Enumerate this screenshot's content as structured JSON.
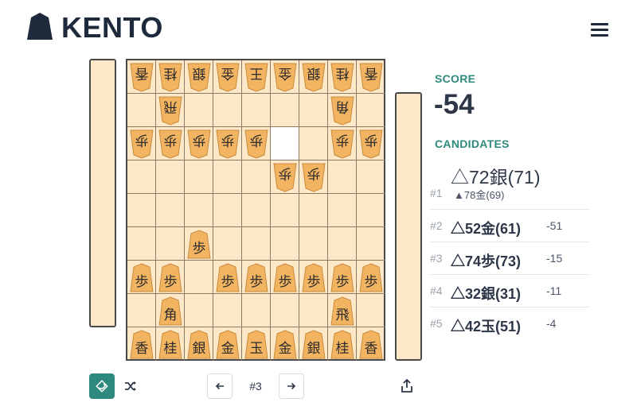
{
  "header": {
    "brand": "KENTO",
    "logo_icon": "shogi-piece-logo-icon",
    "menu_icon": "hamburger-menu-icon"
  },
  "board": {
    "files": 9,
    "ranks": 9,
    "highlight": [
      {
        "file": 4,
        "rank": 3
      }
    ],
    "pieces": [
      {
        "file": 9,
        "rank": 1,
        "char": "香",
        "owner": "gote"
      },
      {
        "file": 8,
        "rank": 1,
        "char": "桂",
        "owner": "gote"
      },
      {
        "file": 7,
        "rank": 1,
        "char": "銀",
        "owner": "gote"
      },
      {
        "file": 6,
        "rank": 1,
        "char": "金",
        "owner": "gote"
      },
      {
        "file": 5,
        "rank": 1,
        "char": "王",
        "owner": "gote"
      },
      {
        "file": 4,
        "rank": 1,
        "char": "金",
        "owner": "gote"
      },
      {
        "file": 3,
        "rank": 1,
        "char": "銀",
        "owner": "gote"
      },
      {
        "file": 2,
        "rank": 1,
        "char": "桂",
        "owner": "gote"
      },
      {
        "file": 1,
        "rank": 1,
        "char": "香",
        "owner": "gote"
      },
      {
        "file": 8,
        "rank": 2,
        "char": "飛",
        "owner": "gote"
      },
      {
        "file": 2,
        "rank": 2,
        "char": "角",
        "owner": "gote"
      },
      {
        "file": 9,
        "rank": 3,
        "char": "歩",
        "owner": "gote"
      },
      {
        "file": 8,
        "rank": 3,
        "char": "歩",
        "owner": "gote"
      },
      {
        "file": 7,
        "rank": 3,
        "char": "歩",
        "owner": "gote"
      },
      {
        "file": 6,
        "rank": 3,
        "char": "歩",
        "owner": "gote"
      },
      {
        "file": 5,
        "rank": 3,
        "char": "歩",
        "owner": "gote"
      },
      {
        "file": 2,
        "rank": 3,
        "char": "歩",
        "owner": "gote"
      },
      {
        "file": 1,
        "rank": 3,
        "char": "歩",
        "owner": "gote"
      },
      {
        "file": 4,
        "rank": 4,
        "char": "歩",
        "owner": "gote"
      },
      {
        "file": 3,
        "rank": 4,
        "char": "歩",
        "owner": "gote"
      },
      {
        "file": 7,
        "rank": 6,
        "char": "歩",
        "owner": "sente"
      },
      {
        "file": 9,
        "rank": 7,
        "char": "歩",
        "owner": "sente"
      },
      {
        "file": 8,
        "rank": 7,
        "char": "歩",
        "owner": "sente"
      },
      {
        "file": 6,
        "rank": 7,
        "char": "歩",
        "owner": "sente"
      },
      {
        "file": 5,
        "rank": 7,
        "char": "歩",
        "owner": "sente"
      },
      {
        "file": 4,
        "rank": 7,
        "char": "歩",
        "owner": "sente"
      },
      {
        "file": 3,
        "rank": 7,
        "char": "歩",
        "owner": "sente"
      },
      {
        "file": 2,
        "rank": 7,
        "char": "歩",
        "owner": "sente"
      },
      {
        "file": 1,
        "rank": 7,
        "char": "歩",
        "owner": "sente"
      },
      {
        "file": 8,
        "rank": 8,
        "char": "角",
        "owner": "sente"
      },
      {
        "file": 2,
        "rank": 8,
        "char": "飛",
        "owner": "sente"
      },
      {
        "file": 9,
        "rank": 9,
        "char": "香",
        "owner": "sente"
      },
      {
        "file": 8,
        "rank": 9,
        "char": "桂",
        "owner": "sente"
      },
      {
        "file": 7,
        "rank": 9,
        "char": "銀",
        "owner": "sente"
      },
      {
        "file": 6,
        "rank": 9,
        "char": "金",
        "owner": "sente"
      },
      {
        "file": 5,
        "rank": 9,
        "char": "玉",
        "owner": "sente"
      },
      {
        "file": 4,
        "rank": 9,
        "char": "金",
        "owner": "sente"
      },
      {
        "file": 3,
        "rank": 9,
        "char": "銀",
        "owner": "sente"
      },
      {
        "file": 2,
        "rank": 9,
        "char": "桂",
        "owner": "sente"
      },
      {
        "file": 1,
        "rank": 9,
        "char": "香",
        "owner": "sente"
      }
    ]
  },
  "analysis": {
    "score_label": "SCORE",
    "score": "-54",
    "candidates_label": "CANDIDATES",
    "candidates": [
      {
        "rank": "#1",
        "move": "△72銀(71)",
        "value": "",
        "pv": "▲78金(69)"
      },
      {
        "rank": "#2",
        "move": "△52金(61)",
        "value": "-51",
        "pv": ""
      },
      {
        "rank": "#3",
        "move": "△74歩(73)",
        "value": "-15",
        "pv": ""
      },
      {
        "rank": "#4",
        "move": "△32銀(31)",
        "value": "-11",
        "pv": ""
      },
      {
        "rank": "#5",
        "move": "△42玉(51)",
        "value": "-4",
        "pv": ""
      }
    ]
  },
  "controls": {
    "flip_icon": "flip-board-icon",
    "shuffle_icon": "shuffle-icon",
    "prev_icon": "arrow-left-icon",
    "next_icon": "arrow-right-icon",
    "share_icon": "share-icon",
    "move_number": "#3"
  },
  "colors": {
    "accent": "#2f8a7e",
    "board": "#fde9c8",
    "piece": "#f3b462",
    "grid": "#8a7a66"
  }
}
